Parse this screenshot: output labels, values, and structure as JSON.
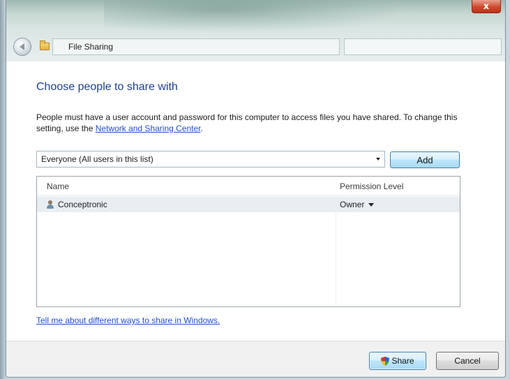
{
  "window": {
    "title": "File Sharing",
    "close_label": "x"
  },
  "content": {
    "heading": "Choose people to share with",
    "description_prefix": "People must have a user account and password for this computer to access files you have shared.  To change this setting, use the ",
    "description_link": "Network and Sharing Center",
    "description_suffix": "."
  },
  "picker": {
    "selected": "Everyone (All users in this list)",
    "add_label": "Add"
  },
  "table": {
    "columns": [
      "Name",
      "Permission Level"
    ],
    "rows": [
      {
        "name": "Conceptronic",
        "permission": "Owner"
      }
    ]
  },
  "help_link": "Tell me about different ways to share in Windows.",
  "footer": {
    "share_label": "Share",
    "cancel_label": "Cancel"
  },
  "colors": {
    "heading": "#1e3f8c",
    "link": "#1f4fc6",
    "button_border_default": "#3c7fb1"
  },
  "icons": {
    "back": "back-arrow-icon",
    "folder": "folder-icon",
    "user": "user-icon",
    "shield": "uac-shield-icon"
  }
}
